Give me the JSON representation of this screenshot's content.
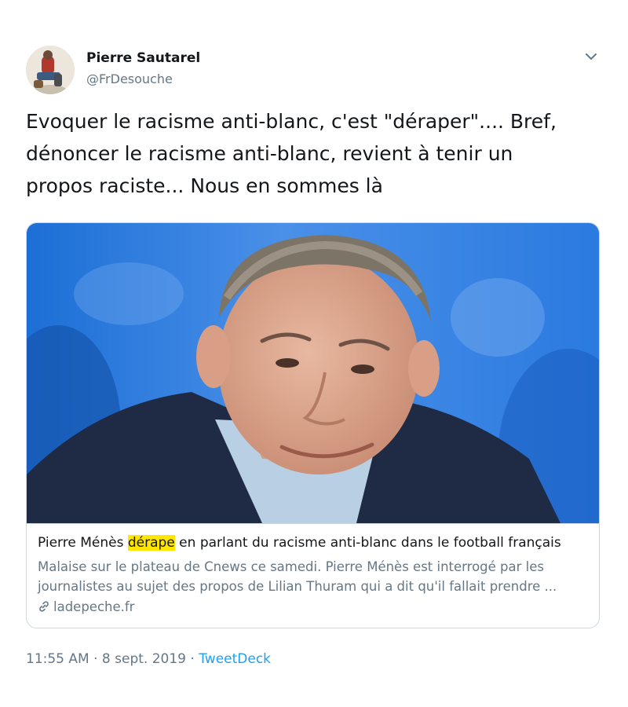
{
  "author": {
    "name": "Pierre Sautarel",
    "handle": "@FrDesouche"
  },
  "tweet": {
    "lines": [
      "Evoquer le racisme anti-blanc, c'est \"déraper\"....  Bref,",
      "dénoncer le racisme anti-blanc, revient à tenir un",
      "propos raciste... Nous en sommes là"
    ]
  },
  "card": {
    "title_before": "Pierre Ménès ",
    "title_highlight": "dérape",
    "title_after": " en parlant du racisme anti-blanc dans le football français",
    "description_lines": [
      "Malaise sur le plateau de Cnews ce samedi. Pierre Ménès est interrogé par les",
      "journalistes au sujet des propos de Lilian Thuram qui a dit qu'il fallait prendre ..."
    ],
    "domain": "ladepeche.fr"
  },
  "meta": {
    "time": "11:55 AM",
    "separator": " · ",
    "date": "8 sept. 2019",
    "source": "TweetDeck"
  },
  "colors": {
    "text": "#14171a",
    "secondary": "#657786",
    "link": "#1da1f2",
    "border": "#ccd6dd",
    "highlight": "#ffe600"
  }
}
